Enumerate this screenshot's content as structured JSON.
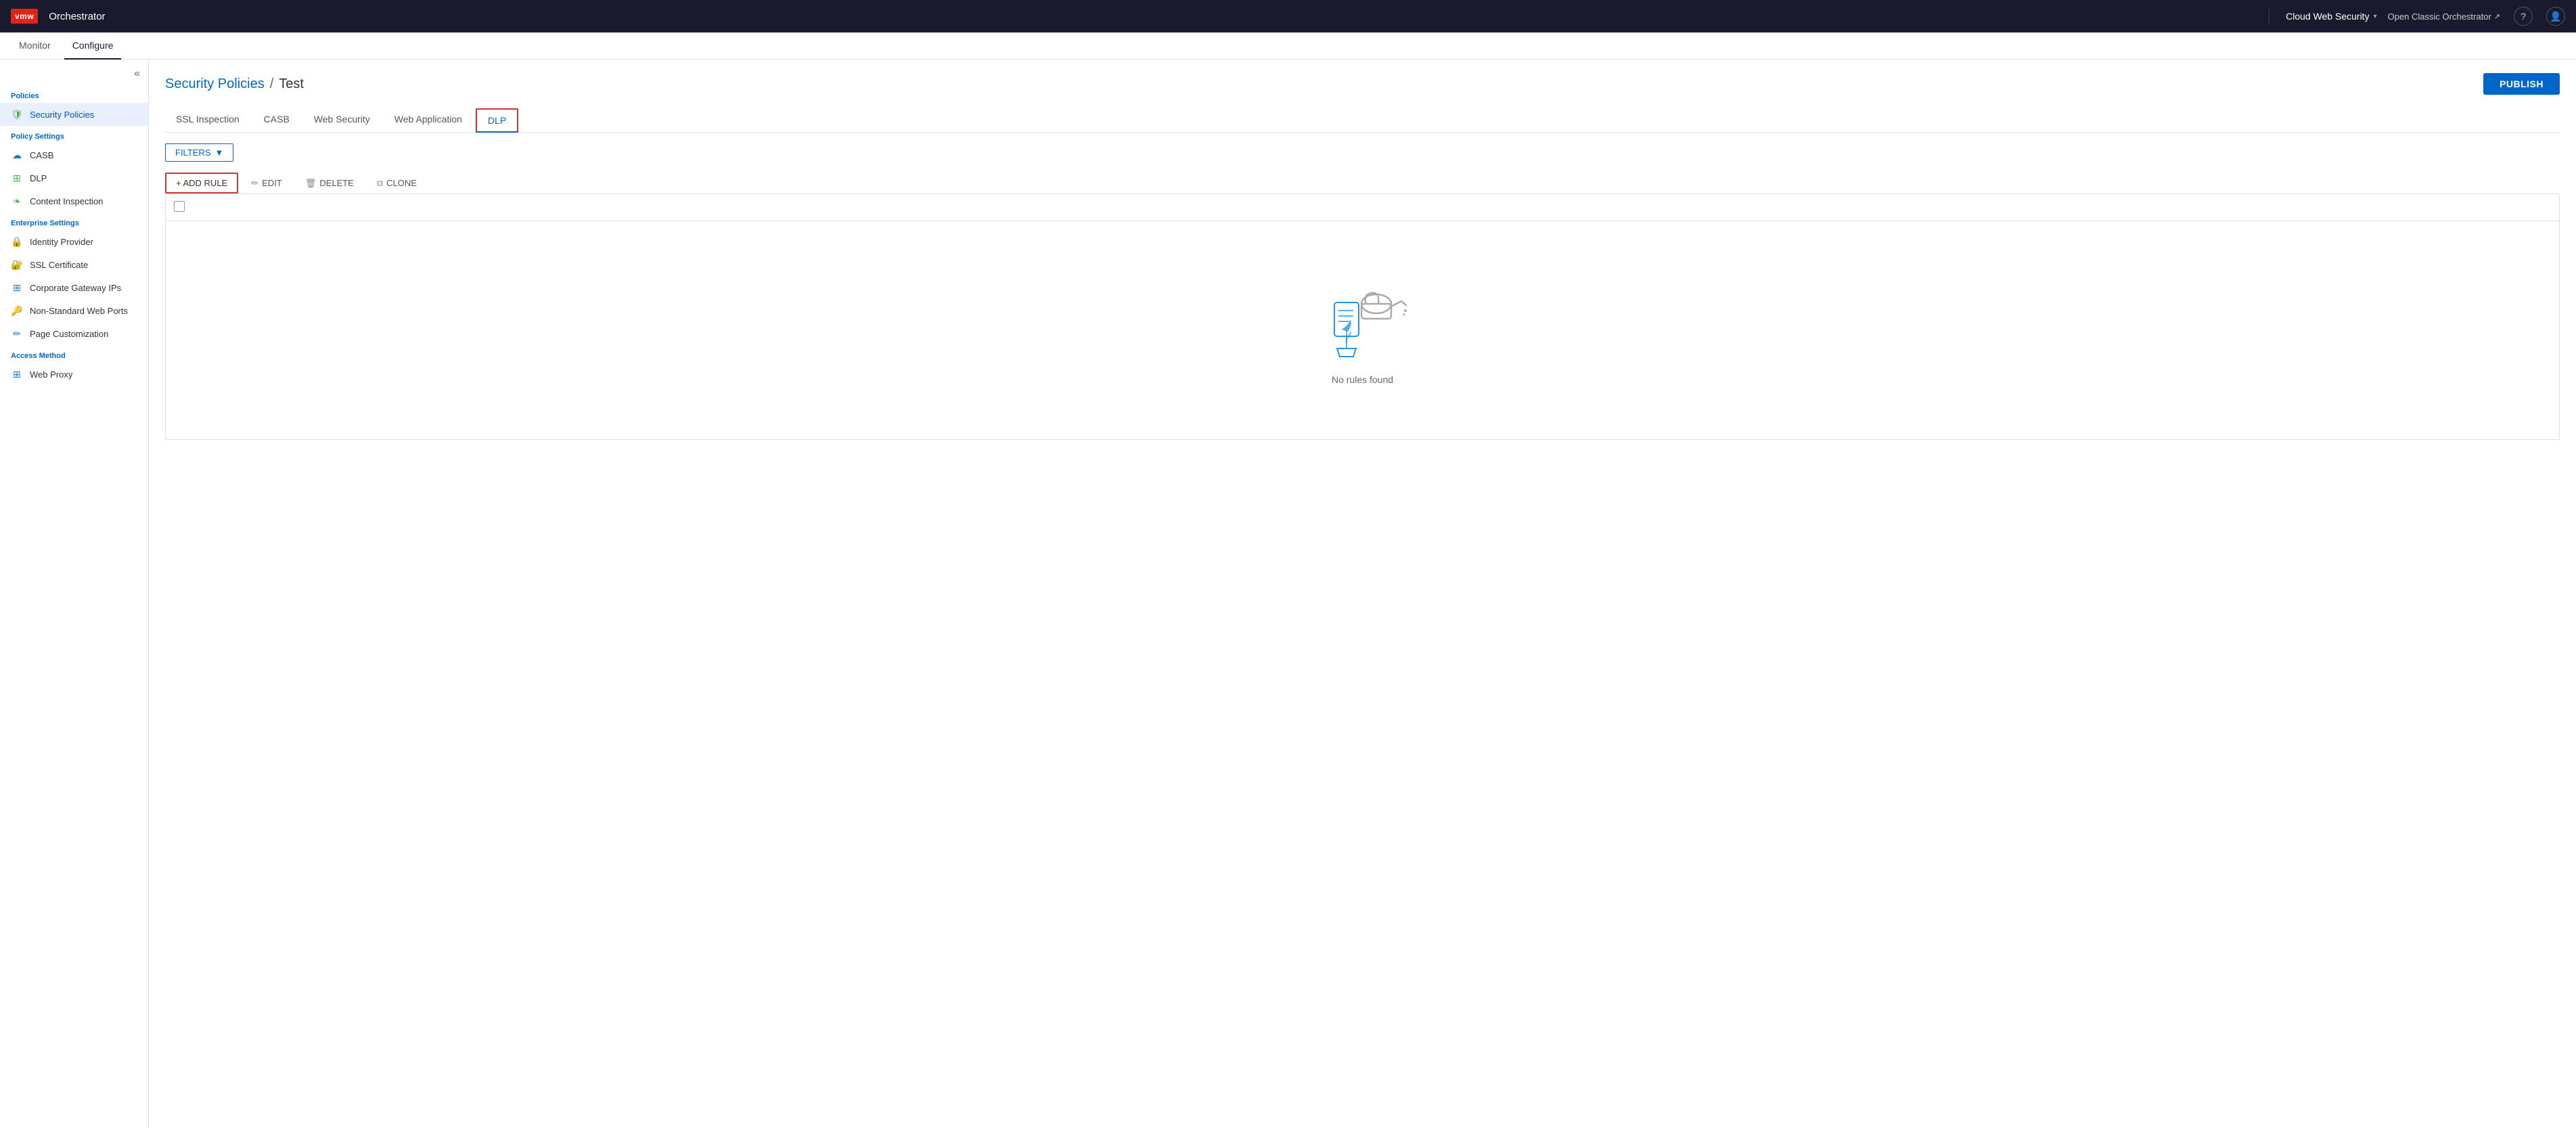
{
  "topNav": {
    "logo": "vmw",
    "appName": "Orchestrator",
    "productName": "Cloud Web Security",
    "openClassic": "Open Classic Orchestrator"
  },
  "secondNav": {
    "tabs": [
      {
        "id": "monitor",
        "label": "Monitor",
        "active": false
      },
      {
        "id": "configure",
        "label": "Configure",
        "active": true
      }
    ]
  },
  "sidebar": {
    "collapseIcon": "«",
    "sections": [
      {
        "label": "Policies",
        "items": [
          {
            "id": "security-policies",
            "label": "Security Policies",
            "icon": "shield",
            "active": true
          }
        ]
      },
      {
        "label": "Policy Settings",
        "items": [
          {
            "id": "casb",
            "label": "CASB",
            "icon": "cloud"
          },
          {
            "id": "dlp",
            "label": "DLP",
            "icon": "grid"
          },
          {
            "id": "content-inspection",
            "label": "Content Inspection",
            "icon": "leaf"
          }
        ]
      },
      {
        "label": "Enterprise Settings",
        "items": [
          {
            "id": "identity-provider",
            "label": "Identity Provider",
            "icon": "cloud-lock"
          },
          {
            "id": "ssl-certificate",
            "label": "SSL Certificate",
            "icon": "lock"
          },
          {
            "id": "corporate-gateway-ips",
            "label": "Corporate Gateway IPs",
            "icon": "grid-lock"
          },
          {
            "id": "non-standard-web-ports",
            "label": "Non-Standard Web Ports",
            "icon": "lock-settings"
          },
          {
            "id": "page-customization",
            "label": "Page Customization",
            "icon": "edit-box"
          }
        ]
      },
      {
        "label": "Access Method",
        "items": [
          {
            "id": "web-proxy",
            "label": "Web Proxy",
            "icon": "grid"
          }
        ]
      }
    ]
  },
  "page": {
    "breadcrumb": {
      "link": "Security Policies",
      "separator": "/",
      "current": "Test"
    },
    "publishButton": "PUBLISH"
  },
  "tabs": [
    {
      "id": "ssl-inspection",
      "label": "SSL Inspection",
      "active": false
    },
    {
      "id": "casb",
      "label": "CASB",
      "active": false
    },
    {
      "id": "web-security",
      "label": "Web Security",
      "active": false
    },
    {
      "id": "web-application",
      "label": "Web Application",
      "active": false
    },
    {
      "id": "dlp",
      "label": "DLP",
      "active": true
    }
  ],
  "toolbar": {
    "filtersLabel": "FILTERS"
  },
  "actions": {
    "addRule": "+ ADD RULE",
    "edit": "EDIT",
    "delete": "DELETE",
    "clone": "CLONE"
  },
  "emptyState": {
    "message": "No rules found"
  }
}
